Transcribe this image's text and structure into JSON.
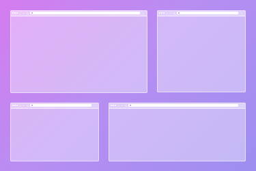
{
  "background": {
    "gradient_from": "#d57cf0",
    "gradient_to": "#9d8ef0"
  },
  "windows": [
    {
      "name": "window-top-left",
      "address_text": "",
      "nav_back": "‹",
      "nav_forward": "›",
      "reload": "↻",
      "menu": "⋮"
    },
    {
      "name": "window-top-right",
      "address_text": "",
      "nav_back": "‹",
      "nav_forward": "›",
      "reload": "↻",
      "menu": "⋮"
    },
    {
      "name": "window-bottom-left",
      "address_text": "",
      "nav_back": "‹",
      "nav_forward": "›",
      "reload": "↻",
      "menu": "⋮"
    },
    {
      "name": "window-bottom-right",
      "address_text": "",
      "nav_back": "‹",
      "nav_forward": "›",
      "reload": "↻",
      "menu": "⋮"
    }
  ]
}
